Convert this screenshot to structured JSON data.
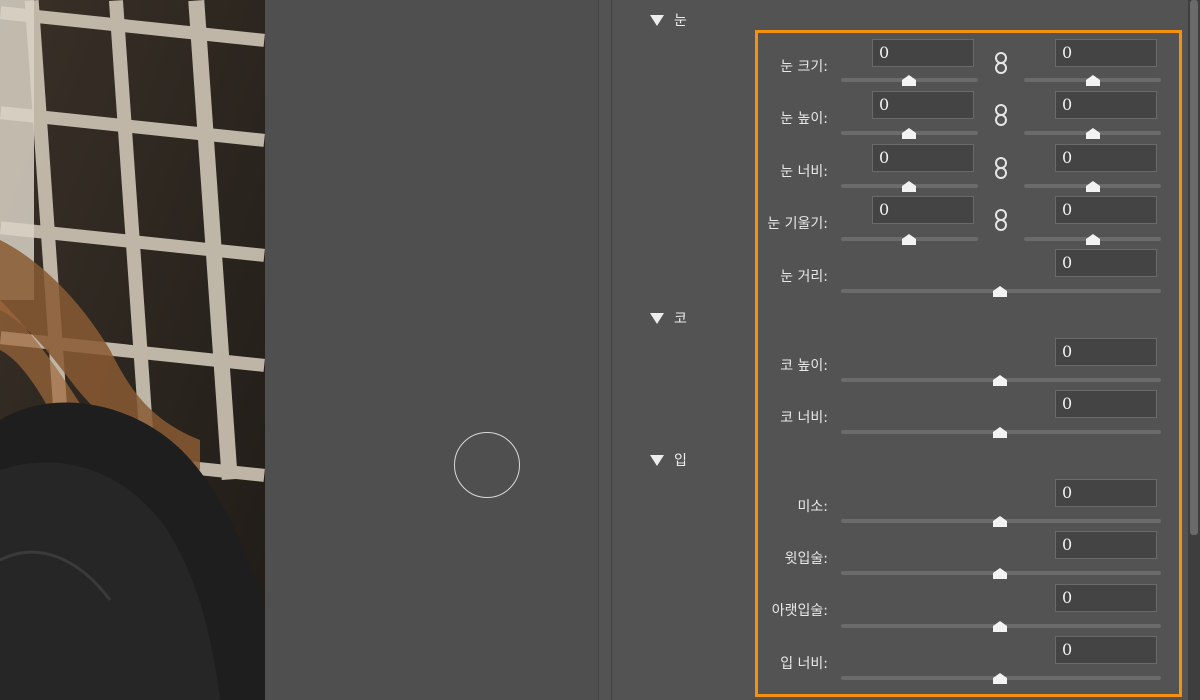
{
  "sections": {
    "eyes": {
      "title": "눈"
    },
    "nose": {
      "title": "코"
    },
    "mouth": {
      "title": "입"
    }
  },
  "eyes": {
    "size": {
      "label": "눈 크기:",
      "left_value": "0",
      "right_value": "0"
    },
    "height": {
      "label": "눈 높이:",
      "left_value": "0",
      "right_value": "0"
    },
    "width": {
      "label": "눈 너비:",
      "left_value": "0",
      "right_value": "0"
    },
    "tilt": {
      "label": "눈 기울기:",
      "left_value": "0",
      "right_value": "0"
    },
    "distance": {
      "label": "눈 거리:",
      "value": "0"
    }
  },
  "nose": {
    "height": {
      "label": "코 높이:",
      "value": "0"
    },
    "width": {
      "label": "코 너비:",
      "value": "0"
    }
  },
  "mouth": {
    "smile": {
      "label": "미소:",
      "value": "0"
    },
    "upper_lip": {
      "label": "윗입술:",
      "value": "0"
    },
    "lower_lip": {
      "label": "아랫입술:",
      "value": "0"
    },
    "mouth_width": {
      "label": "입 너비:",
      "value": "0"
    }
  },
  "colors": {
    "highlight": "#f5910d",
    "panel_bg": "#535353",
    "field_bg": "#444444"
  },
  "icons": {
    "section_toggle": "triangle-down-icon",
    "link": "chain-link-icon",
    "slider_thumb": "slider-thumb-icon"
  }
}
